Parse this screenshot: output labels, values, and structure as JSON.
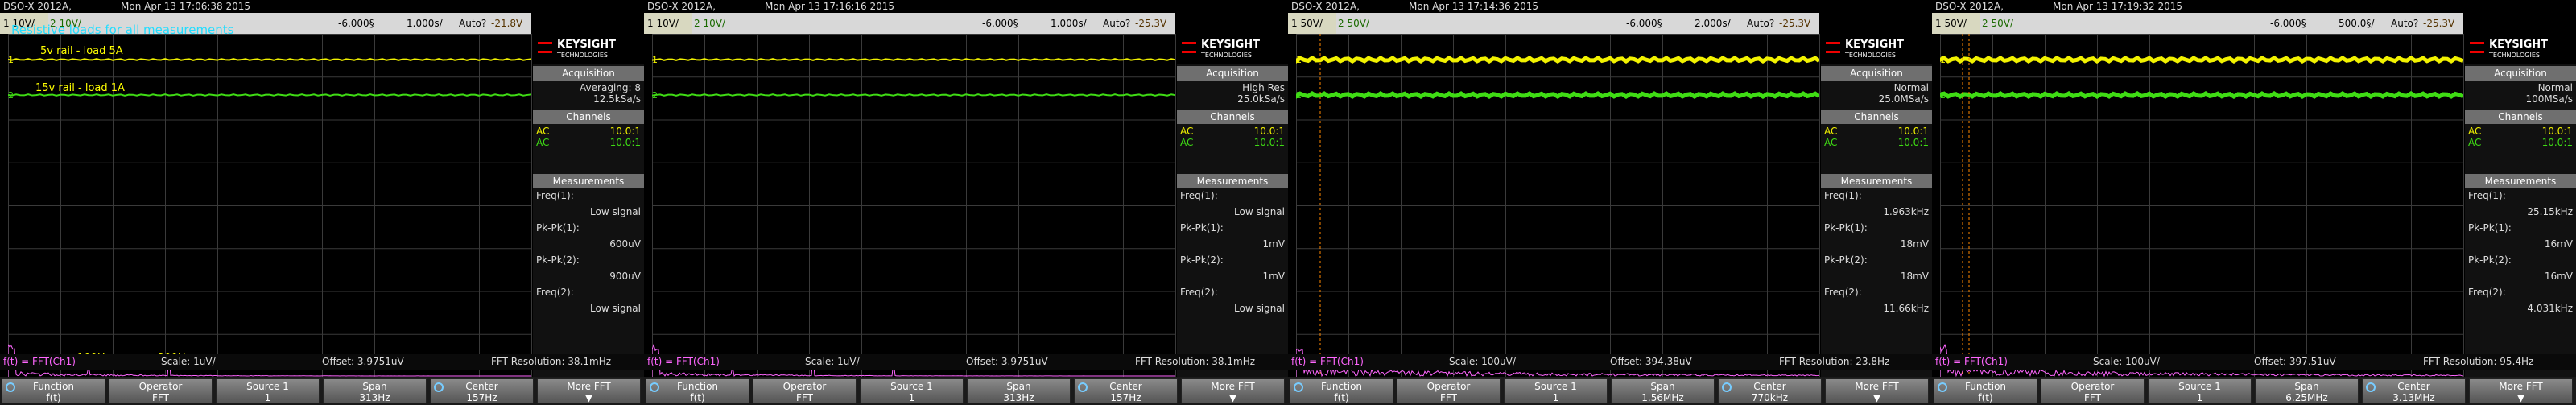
{
  "colors": {
    "ch1": "#f2f200",
    "ch2": "#3fdc14",
    "fft": "#ff66ff",
    "annotation": "#22ddff",
    "label": "#ffff00"
  },
  "panels": [
    {
      "model": "DSO-X 2012A,",
      "datetime": "Mon Apr 13 17:06:38 2015",
      "ch1_scale": "1  10V/",
      "ch2_scale": "2  10V/",
      "time_offset": "-6.000§",
      "time_scale": "1.000s/",
      "trigger": "Auto?",
      "trig_level": "-21.8V",
      "acq_mode": "Averaging: 8",
      "sample_rate": "12.5kSa/s",
      "ch_rows": [
        {
          "c": "AC",
          "v": "10.0:1"
        },
        {
          "c": "AC",
          "v": "10.0:1"
        }
      ],
      "meas": [
        {
          "l": "Freq(1):",
          "r": ""
        },
        {
          "l": "",
          "r": "Low signal"
        },
        {
          "l": "Pk-Pk(1):",
          "r": ""
        },
        {
          "l": "",
          "r": "600uV"
        },
        {
          "l": "Pk-Pk(2):",
          "r": ""
        },
        {
          "l": "",
          "r": "900uV"
        },
        {
          "l": "Freq(2):",
          "r": ""
        },
        {
          "l": "",
          "r": "Low signal"
        }
      ],
      "fft": {
        "f": "f(t) = FFT(Ch1)",
        "scale": "Scale: 1uV/",
        "offset": "Offset: 3.9751uV",
        "res": "FFT Resolution: 38.1mHz"
      },
      "buttons": [
        {
          "t": "Function",
          "v": "f(t)"
        },
        {
          "t": "Operator",
          "v": "FFT"
        },
        {
          "t": "Source 1",
          "v": "1"
        },
        {
          "t": "Span",
          "v": "313Hz"
        },
        {
          "t": "Center",
          "v": "157Hz"
        },
        {
          "t": "More FFT",
          "v": "▼"
        }
      ],
      "notes": {
        "title": "Resistive loads for all measurements",
        "rail5": "5v rail - load 5A",
        "rail15": "15v rail - load 1A",
        "h100": "100Hz",
        "h200": "200Hz"
      }
    },
    {
      "model": "DSO-X 2012A,",
      "datetime": "Mon Apr 13 17:16:16 2015",
      "ch1_scale": "1  10V/",
      "ch2_scale": "2  10V/",
      "time_offset": "-6.000§",
      "time_scale": "1.000s/",
      "trigger": "Auto?",
      "trig_level": "-25.3V",
      "acq_mode": "High Res",
      "sample_rate": "25.0kSa/s",
      "ch_rows": [
        {
          "c": "AC",
          "v": "10.0:1"
        },
        {
          "c": "AC",
          "v": "10.0:1"
        }
      ],
      "meas": [
        {
          "l": "Freq(1):",
          "r": ""
        },
        {
          "l": "",
          "r": "Low signal"
        },
        {
          "l": "Pk-Pk(1):",
          "r": ""
        },
        {
          "l": "",
          "r": "1mV"
        },
        {
          "l": "Pk-Pk(2):",
          "r": ""
        },
        {
          "l": "",
          "r": "1mV"
        },
        {
          "l": "Freq(2):",
          "r": ""
        },
        {
          "l": "",
          "r": "Low signal"
        }
      ],
      "fft": {
        "f": "f(t) = FFT(Ch1)",
        "scale": "Scale: 1uV/",
        "offset": "Offset: 3.9751uV",
        "res": "FFT Resolution: 38.1mHz"
      },
      "buttons": [
        {
          "t": "Function",
          "v": "f(t)"
        },
        {
          "t": "Operator",
          "v": "FFT"
        },
        {
          "t": "Source 1",
          "v": "1"
        },
        {
          "t": "Span",
          "v": "313Hz"
        },
        {
          "t": "Center",
          "v": "157Hz"
        },
        {
          "t": "More FFT",
          "v": "▼"
        }
      ]
    },
    {
      "model": "DSO-X 2012A,",
      "datetime": "Mon Apr 13 17:14:36 2015",
      "ch1_scale": "1  50V/",
      "ch2_scale": "2  50V/",
      "time_offset": "-6.000§",
      "time_scale": "2.000s/",
      "trigger": "Auto?",
      "trig_level": "-25.3V",
      "acq_mode": "Normal",
      "sample_rate": "25.0MSa/s",
      "ch_rows": [
        {
          "c": "AC",
          "v": "10.0:1"
        },
        {
          "c": "AC",
          "v": "10.0:1"
        }
      ],
      "meas": [
        {
          "l": "Freq(1):",
          "r": ""
        },
        {
          "l": "",
          "r": "1.963kHz"
        },
        {
          "l": "Pk-Pk(1):",
          "r": ""
        },
        {
          "l": "",
          "r": "18mV"
        },
        {
          "l": "Pk-Pk(2):",
          "r": ""
        },
        {
          "l": "",
          "r": "18mV"
        },
        {
          "l": "Freq(2):",
          "r": ""
        },
        {
          "l": "",
          "r": "11.66kHz"
        }
      ],
      "fft": {
        "f": "f(t) = FFT(Ch1)",
        "scale": "Scale: 100uV/",
        "offset": "Offset: 394.38uV",
        "res": "FFT Resolution: 23.8Hz"
      },
      "buttons": [
        {
          "t": "Function",
          "v": "f(t)"
        },
        {
          "t": "Operator",
          "v": "FFT"
        },
        {
          "t": "Source 1",
          "v": "1"
        },
        {
          "t": "Span",
          "v": "1.56MHz"
        },
        {
          "t": "Center",
          "v": "770kHz"
        },
        {
          "t": "More FFT",
          "v": "▼"
        }
      ]
    },
    {
      "model": "DSO-X 2012A,",
      "datetime": "Mon Apr 13 17:19:32 2015",
      "ch1_scale": "1  50V/",
      "ch2_scale": "2  50V/",
      "time_offset": "-6.000§",
      "time_scale": "500.0§/",
      "trigger": "Auto?",
      "trig_level": "-25.3V",
      "acq_mode": "Normal",
      "sample_rate": "100MSa/s",
      "ch_rows": [
        {
          "c": "AC",
          "v": "10.0:1"
        },
        {
          "c": "AC",
          "v": "10.0:1"
        }
      ],
      "meas": [
        {
          "l": "Freq(1):",
          "r": ""
        },
        {
          "l": "",
          "r": "25.15kHz"
        },
        {
          "l": "Pk-Pk(1):",
          "r": ""
        },
        {
          "l": "",
          "r": "16mV"
        },
        {
          "l": "Pk-Pk(2):",
          "r": ""
        },
        {
          "l": "",
          "r": "16mV"
        },
        {
          "l": "Freq(2):",
          "r": ""
        },
        {
          "l": "",
          "r": "4.031kHz"
        }
      ],
      "fft": {
        "f": "f(t) = FFT(Ch1)",
        "scale": "Scale: 100uV/",
        "offset": "Offset: 397.51uV",
        "res": "FFT Resolution: 95.4Hz"
      },
      "buttons": [
        {
          "t": "Function",
          "v": "f(t)"
        },
        {
          "t": "Operator",
          "v": "FFT"
        },
        {
          "t": "Source 1",
          "v": "1"
        },
        {
          "t": "Span",
          "v": "6.25MHz"
        },
        {
          "t": "Center",
          "v": "3.13MHz"
        },
        {
          "t": "More FFT",
          "v": "▼"
        }
      ]
    }
  ],
  "side_labels": {
    "brand": "KEYSIGHT",
    "sub": "TECHNOLOGIES",
    "acq": "Acquisition",
    "chan": "Channels",
    "meas": "Measurements"
  }
}
